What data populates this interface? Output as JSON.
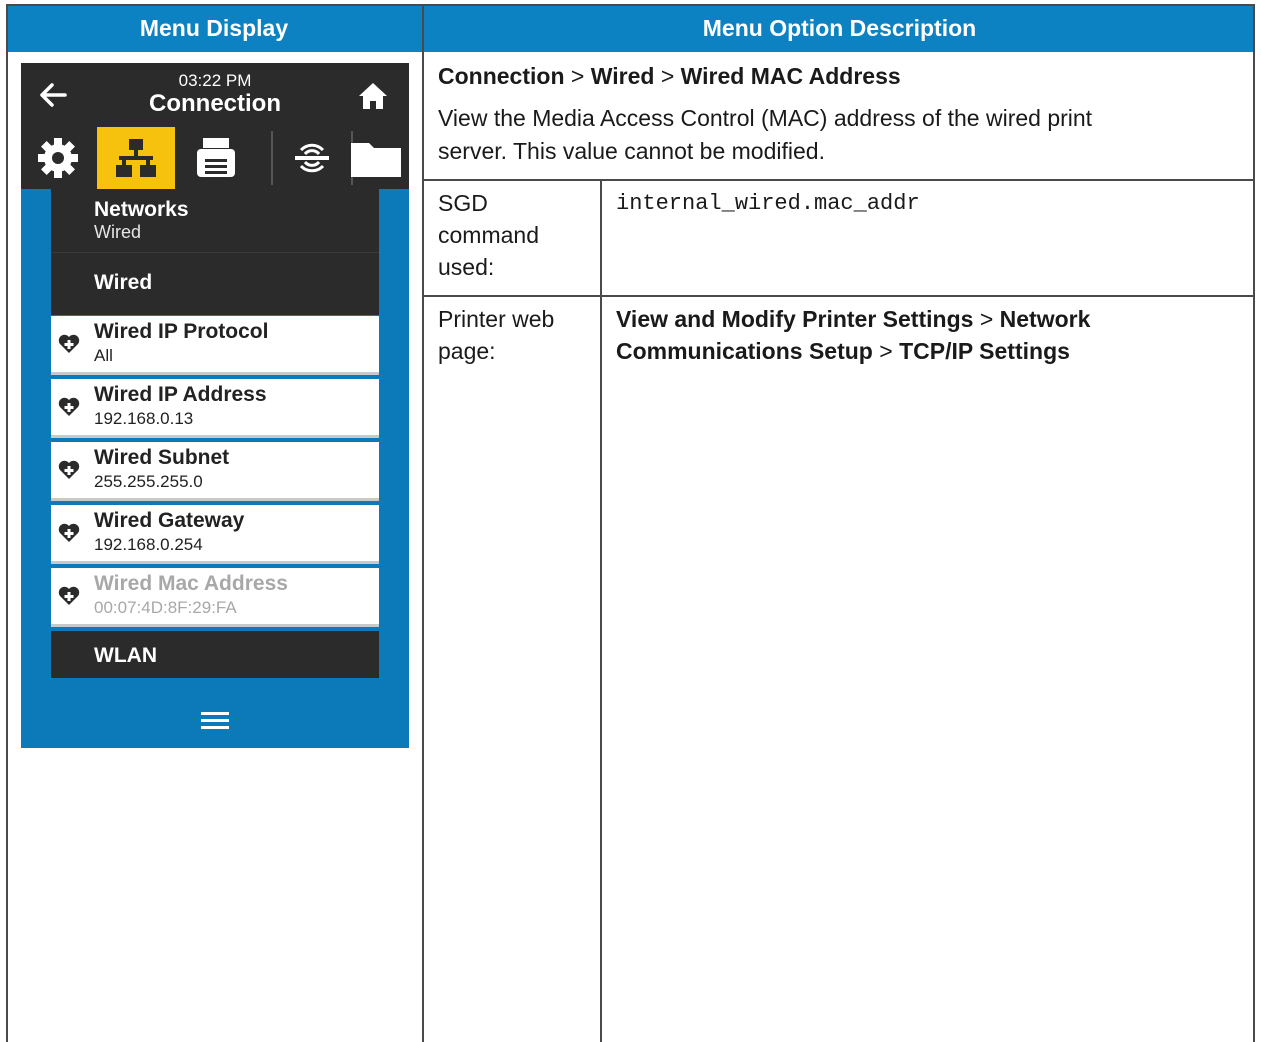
{
  "table": {
    "col_left_header": "Menu Display",
    "col_right_header": "Menu Option Description"
  },
  "description": {
    "breadcrumb": [
      "Connection",
      "Wired",
      "Wired MAC Address"
    ],
    "separator": ">",
    "text_line1": "View the Media Access Control (MAC) address of the wired print",
    "text_line2": "server. This value cannot be modified.",
    "sgd_label": [
      "SGD",
      "command",
      "used:"
    ],
    "sgd_command": "internal_wired.mac_addr",
    "web_label": [
      "Printer web",
      "page:"
    ],
    "web_path_part1": "View and Modify Printer Settings",
    "web_path_part2a": "Network",
    "web_path_part2b": "Communications Setup",
    "web_path_part3": "TCP/IP Settings"
  },
  "display": {
    "time": "03:22 PM",
    "title": "Connection",
    "tabs": [
      {
        "icon": "gear-icon",
        "active": false
      },
      {
        "icon": "network-icon",
        "active": true
      },
      {
        "icon": "printer-icon",
        "active": false
      },
      {
        "icon": "antenna-icon",
        "active": false
      },
      {
        "icon": "folder-icon",
        "active": false
      }
    ],
    "section_networks": {
      "label": "Networks",
      "sub": "Wired"
    },
    "section_wired": "Wired",
    "items": [
      {
        "label": "Wired IP Protocol",
        "value": "All",
        "disabled": false
      },
      {
        "label": "Wired IP Address",
        "value": "192.168.0.13",
        "disabled": false
      },
      {
        "label": "Wired Subnet",
        "value": "255.255.255.0",
        "disabled": false
      },
      {
        "label": "Wired Gateway",
        "value": "192.168.0.254",
        "disabled": false
      },
      {
        "label": "Wired Mac Address",
        "value": "00:07:4D:8F:29:FA",
        "disabled": true
      }
    ],
    "section_wlan": "WLAN",
    "colors": {
      "accent": "#0c82c2",
      "active_tab": "#f7c20e",
      "bar": "#2b2b2b"
    }
  }
}
